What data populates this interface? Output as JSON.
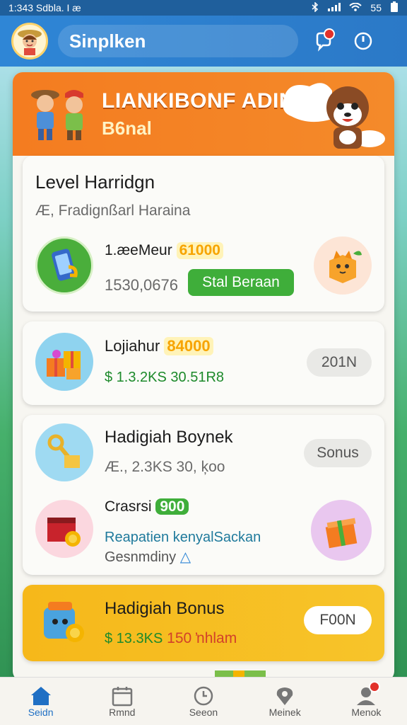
{
  "status_bar": {
    "left_text": "1:343 Sdbla.  I æ",
    "right_text": "55"
  },
  "header": {
    "title": "Sinplken"
  },
  "banner": {
    "title": "LIANKIBONF ADINS",
    "subtitle": "B6nal"
  },
  "level_card": {
    "title": "Level Harridgn",
    "subtitle": "Æ, Fradignßarl Haraina",
    "item_name": "1.æeMeur",
    "item_badge": "61000",
    "item_value": "1530,0676",
    "button_label": "Stal Beraan"
  },
  "gift_card": {
    "title": "Lojiahur",
    "badge": "84000",
    "value": "$ 1.3.2KS 30.51R8",
    "pill_label": "201N"
  },
  "hadiah_card": {
    "title": "Hadigiah Boynek",
    "subtitle": "Æ., 2.3KS 30, ķoo",
    "pill_label": "Sonus",
    "row2_title": "Crasrsi",
    "row2_badge": "900",
    "row2_link": "Reapatien kenyalSackan",
    "row2_sub": "Gesnmdiny"
  },
  "bonus_card": {
    "title": "Hadigiah Bonus",
    "value_green": "$ 13.3KS",
    "value_red": "150 ŉhlam",
    "pill_label": "F00N"
  },
  "bottom_nav": {
    "items": [
      {
        "label": "Seidn",
        "icon": "home-icon"
      },
      {
        "label": "Rmnd",
        "icon": "calendar-icon"
      },
      {
        "label": "Seeon",
        "icon": "clock-icon"
      },
      {
        "label": "Meinek",
        "icon": "location-icon"
      },
      {
        "label": "Menok",
        "icon": "profile-icon"
      }
    ]
  },
  "colors": {
    "primary": "#2f86d6",
    "banner": "#f47c20",
    "green_button": "#3fae3a",
    "bonus_yellow": "#f6b81a",
    "badge_red": "#e2312a"
  }
}
